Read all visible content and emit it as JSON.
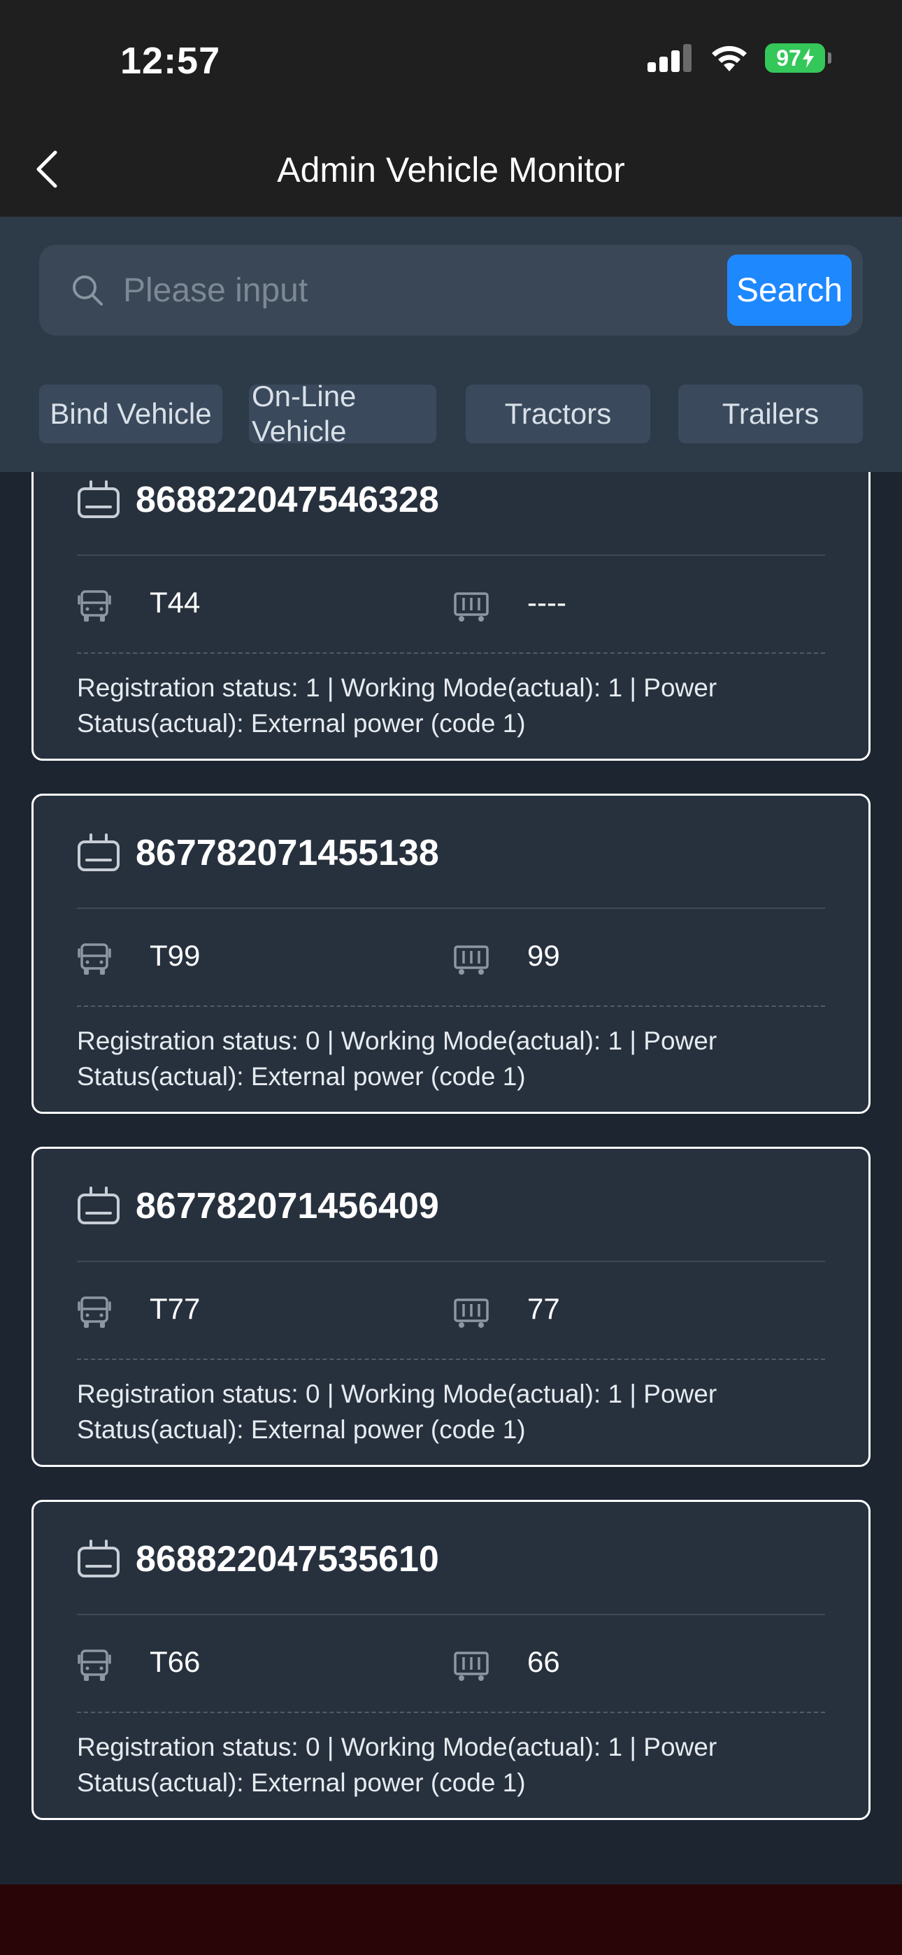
{
  "status_bar": {
    "time": "12:57",
    "battery": "97"
  },
  "nav": {
    "title": "Admin Vehicle Monitor"
  },
  "search": {
    "placeholder": "Please input",
    "button_label": "Search"
  },
  "tabs": [
    {
      "label": "Bind Vehicle"
    },
    {
      "label": "On-Line Vehicle"
    },
    {
      "label": "Tractors"
    },
    {
      "label": "Trailers"
    }
  ],
  "devices": [
    {
      "id": "868822047546328",
      "tractor": "T44",
      "trailer": "----",
      "status": "Registration status: 1 | Working Mode(actual): 1 | Power Status(actual): External power (code 1)"
    },
    {
      "id": "867782071455138",
      "tractor": "T99",
      "trailer": "99",
      "status": "Registration status: 0 | Working Mode(actual): 1 | Power Status(actual): External power (code 1)"
    },
    {
      "id": "867782071456409",
      "tractor": "T77",
      "trailer": "77",
      "status": "Registration status: 0 | Working Mode(actual): 1 | Power Status(actual): External power (code 1)"
    },
    {
      "id": "868822047535610",
      "tractor": "T66",
      "trailer": "66",
      "status": "Registration status: 0 | Working Mode(actual): 1 | Power Status(actual): External power (code 1)"
    }
  ]
}
